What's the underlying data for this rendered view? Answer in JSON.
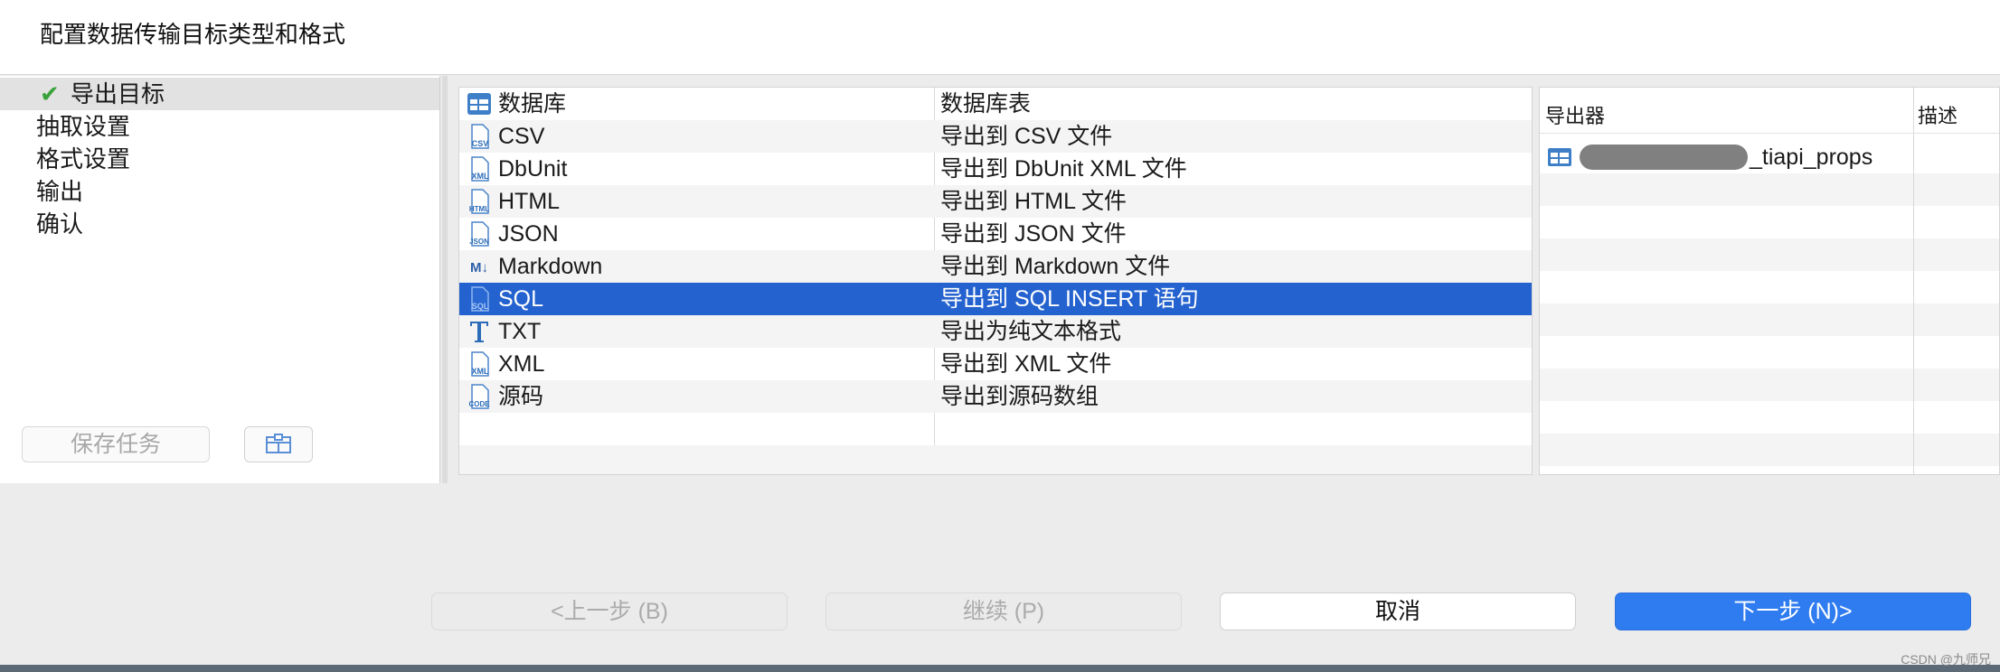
{
  "header": {
    "title": "配置数据传输目标类型和格式"
  },
  "sidebar": {
    "items": [
      {
        "label": "导出目标",
        "selected": true
      },
      {
        "label": "抽取设置"
      },
      {
        "label": "格式设置"
      },
      {
        "label": "输出"
      },
      {
        "label": "确认"
      }
    ],
    "save_task_label": "保存任务"
  },
  "formats": {
    "header": {
      "name": "数据库",
      "desc": "数据库表"
    },
    "rows": [
      {
        "name": "CSV",
        "desc": "导出到 CSV 文件",
        "icon": "csv-icon"
      },
      {
        "name": "DbUnit",
        "desc": "导出到 DbUnit XML 文件",
        "icon": "xml-icon"
      },
      {
        "name": "HTML",
        "desc": "导出到 HTML 文件",
        "icon": "html-icon"
      },
      {
        "name": "JSON",
        "desc": "导出到 JSON 文件",
        "icon": "json-icon"
      },
      {
        "name": "Markdown",
        "desc": "导出到 Markdown 文件",
        "icon": "markdown-icon"
      },
      {
        "name": "SQL",
        "desc": "导出到 SQL INSERT 语句",
        "icon": "sql-icon",
        "selected": true
      },
      {
        "name": "TXT",
        "desc": "导出为纯文本格式",
        "icon": "text-icon"
      },
      {
        "name": "XML",
        "desc": "导出到 XML 文件",
        "icon": "xml-icon"
      },
      {
        "name": "源码",
        "desc": "导出到源码数组",
        "icon": "code-icon"
      }
    ]
  },
  "exporter": {
    "col_exporter": "导出器",
    "col_desc": "描述",
    "item": "_tiapi_props"
  },
  "buttons": {
    "back": "<上一步 (B)",
    "continue": "继续 (P)",
    "cancel": "取消",
    "next": "下一步 (N)>"
  },
  "watermark": "CSDN @九师兄",
  "colors": {
    "selection": "#2462cf",
    "primary": "#2f7cf0",
    "check": "#3aa23a"
  }
}
